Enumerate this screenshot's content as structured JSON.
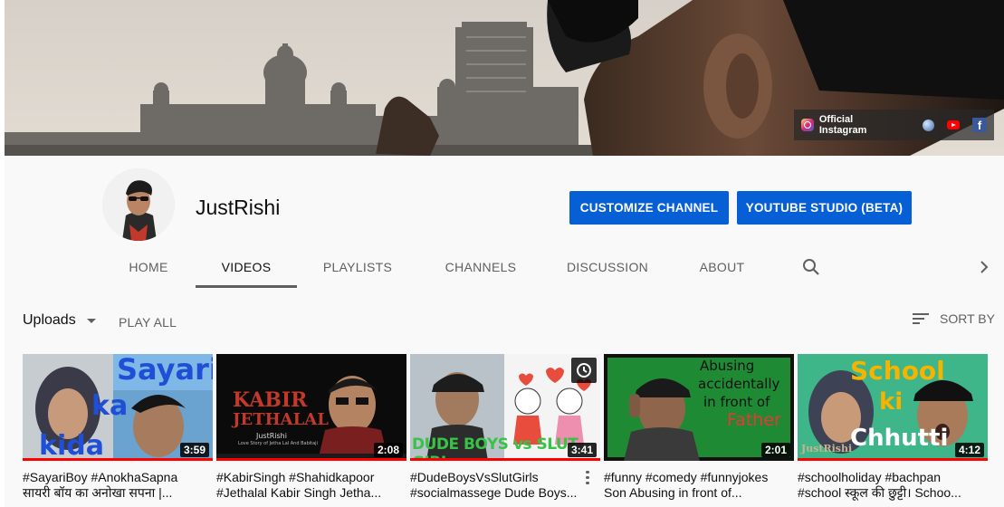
{
  "banner": {
    "instagram_label": "Official Instagram",
    "link_icons": [
      "instagram-icon",
      "globe-icon",
      "youtube-icon",
      "facebook-icon"
    ]
  },
  "channel": {
    "name": "JustRishi",
    "customize_label": "CUSTOMIZE CHANNEL",
    "studio_label": "YOUTUBE STUDIO (BETA)",
    "accent_color": "#065fd4"
  },
  "tabs": [
    {
      "label": "HOME"
    },
    {
      "label": "VIDEOS",
      "active": true
    },
    {
      "label": "PLAYLISTS"
    },
    {
      "label": "CHANNELS"
    },
    {
      "label": "DISCUSSION"
    },
    {
      "label": "ABOUT"
    }
  ],
  "toolbar": {
    "uploads_label": "Uploads",
    "play_all_label": "PLAY ALL",
    "sort_label": "SORT BY"
  },
  "videos": [
    {
      "thumb_text": [
        "Sayari",
        "ka",
        "kida"
      ],
      "duration": "3:59",
      "title_line1": "#SayariBoy #AnokhaSapna",
      "title_line2": "सायरी बॉय का अनोखा सपना |..."
    },
    {
      "thumb_text": [
        "KABIR",
        "JETHALAL",
        "JustRishi",
        "Love Story of Jetha Lal And Babitaji"
      ],
      "duration": "2:08",
      "title_line1": "#KabirSingh #Shahidkapoor",
      "title_line2": "#Jethalal Kabir Singh Jetha..."
    },
    {
      "thumb_text": [
        "DUDE BOYS vs SLUT GIRL"
      ],
      "duration": "3:41",
      "title_line1": "#DudeBoysVsSlutGirls",
      "title_line2": "#socialmassege Dude Boys..."
    },
    {
      "thumb_text": [
        "Abusing",
        "accidentally",
        "in front of",
        "Father"
      ],
      "duration": "2:01",
      "title_line1": "#funny #comedy #funnyjokes",
      "title_line2": "Son Abusing in front of..."
    },
    {
      "thumb_text": [
        "School",
        "ki",
        "Chhutti",
        "JustRishi"
      ],
      "duration": "4:12",
      "title_line1": "#schoolholiday #bachpan",
      "title_line2": "#school स्कूल की छुट्टी। Schoo..."
    }
  ]
}
